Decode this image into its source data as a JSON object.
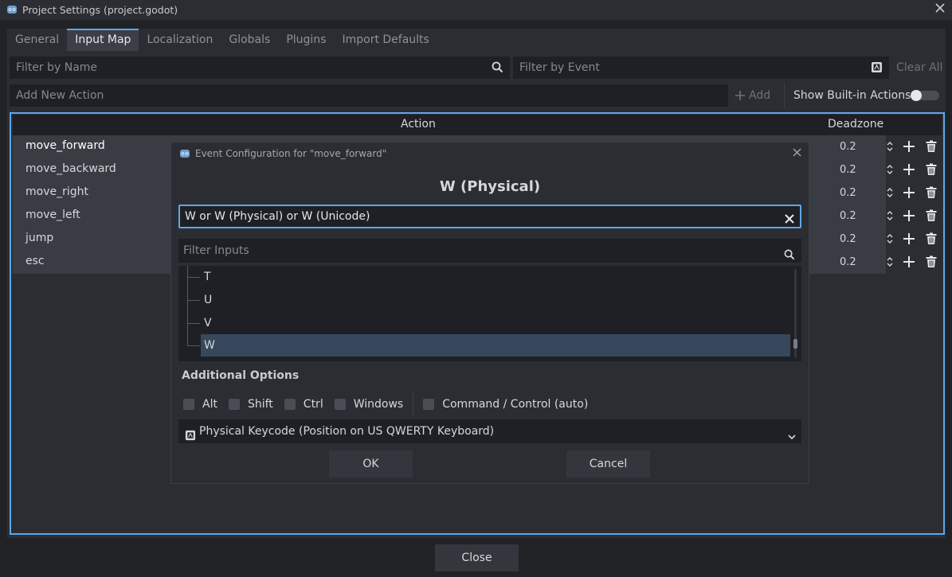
{
  "window": {
    "title": "Project Settings (project.godot)"
  },
  "tabs": [
    {
      "label": "General"
    },
    {
      "label": "Input Map"
    },
    {
      "label": "Localization"
    },
    {
      "label": "Globals"
    },
    {
      "label": "Plugins"
    },
    {
      "label": "Import Defaults"
    }
  ],
  "filters": {
    "by_name_placeholder": "Filter by Name",
    "by_event_placeholder": "Filter by Event",
    "clear_all": "Clear All"
  },
  "add_action": {
    "placeholder": "Add New Action",
    "add_label": "Add",
    "show_builtin_label": "Show Built-in Actions",
    "show_builtin_on": false
  },
  "table": {
    "col_action": "Action",
    "col_deadzone": "Deadzone",
    "rows": [
      {
        "name": "move_forward",
        "deadzone": "0.2"
      },
      {
        "name": "move_backward",
        "deadzone": "0.2"
      },
      {
        "name": "move_right",
        "deadzone": "0.2"
      },
      {
        "name": "move_left",
        "deadzone": "0.2"
      },
      {
        "name": "jump",
        "deadzone": "0.2"
      },
      {
        "name": "esc",
        "deadzone": "0.2"
      }
    ]
  },
  "footer": {
    "close_label": "Close"
  },
  "dialog": {
    "title": "Event Configuration for \"move_forward\"",
    "heading": "W (Physical)",
    "event_value": "W or W (Physical) or W (Unicode)",
    "filter_placeholder": "Filter Inputs",
    "keys": [
      "T",
      "U",
      "V",
      "W"
    ],
    "selected_key": "W",
    "additional_options_title": "Additional Options",
    "modifiers": [
      "Alt",
      "Shift",
      "Ctrl",
      "Windows"
    ],
    "command_control": "Command / Control (auto)",
    "keycode_mode": "Physical Keycode (Position on US QWERTY Keyboard)",
    "ok_label": "OK",
    "cancel_label": "Cancel"
  },
  "colors": {
    "accent": "#5fa6e9",
    "selection": "#37485c",
    "panel": "#2b2d33",
    "field": "#1f2025"
  }
}
